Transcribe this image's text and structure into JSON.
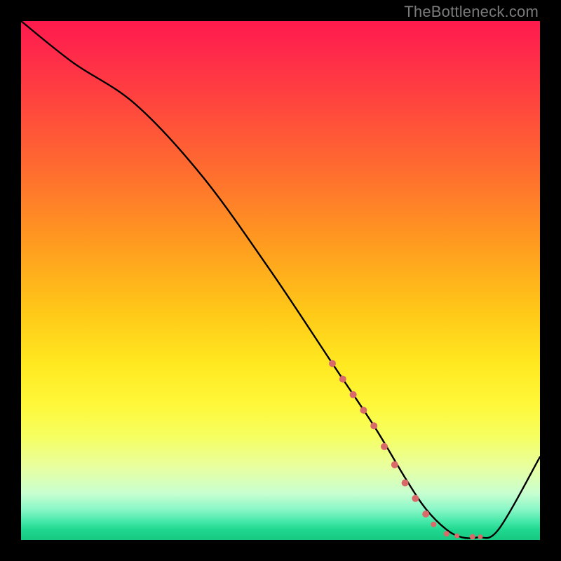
{
  "watermark": {
    "text": "TheBottleneck.com"
  },
  "chart_data": {
    "type": "line",
    "title": "",
    "xlabel": "",
    "ylabel": "",
    "xlim": [
      0,
      100
    ],
    "ylim": [
      0,
      100
    ],
    "grid": false,
    "legend": false,
    "series": [
      {
        "name": "curve",
        "x": [
          0,
          10,
          22,
          35,
          48,
          60,
          68,
          74,
          78,
          82,
          85,
          88,
          92,
          100
        ],
        "y": [
          100,
          92,
          84,
          70,
          52,
          34,
          22,
          12,
          6,
          2,
          0.5,
          0.5,
          2,
          16
        ]
      }
    ],
    "markers": {
      "name": "highlight-dots",
      "color": "#d96a6a",
      "points": [
        {
          "x": 60,
          "y": 34,
          "r": 5
        },
        {
          "x": 62,
          "y": 31,
          "r": 5
        },
        {
          "x": 64,
          "y": 28,
          "r": 5
        },
        {
          "x": 66,
          "y": 25,
          "r": 5
        },
        {
          "x": 68,
          "y": 22,
          "r": 5
        },
        {
          "x": 70,
          "y": 18,
          "r": 5
        },
        {
          "x": 72,
          "y": 14.5,
          "r": 5
        },
        {
          "x": 74,
          "y": 11,
          "r": 5
        },
        {
          "x": 76,
          "y": 8,
          "r": 5
        },
        {
          "x": 78,
          "y": 5,
          "r": 5
        },
        {
          "x": 79.5,
          "y": 3,
          "r": 4
        },
        {
          "x": 82,
          "y": 1.2,
          "r": 4
        },
        {
          "x": 84,
          "y": 0.8,
          "r": 3.5
        },
        {
          "x": 87,
          "y": 0.6,
          "r": 4
        },
        {
          "x": 88.5,
          "y": 0.6,
          "r": 3.5
        }
      ]
    },
    "background": {
      "type": "vertical-gradient",
      "stops": [
        {
          "pos": 0,
          "color": "#ff1a4d"
        },
        {
          "pos": 50,
          "color": "#ffd028"
        },
        {
          "pos": 80,
          "color": "#f8ff60"
        },
        {
          "pos": 100,
          "color": "#16c880"
        }
      ]
    }
  }
}
